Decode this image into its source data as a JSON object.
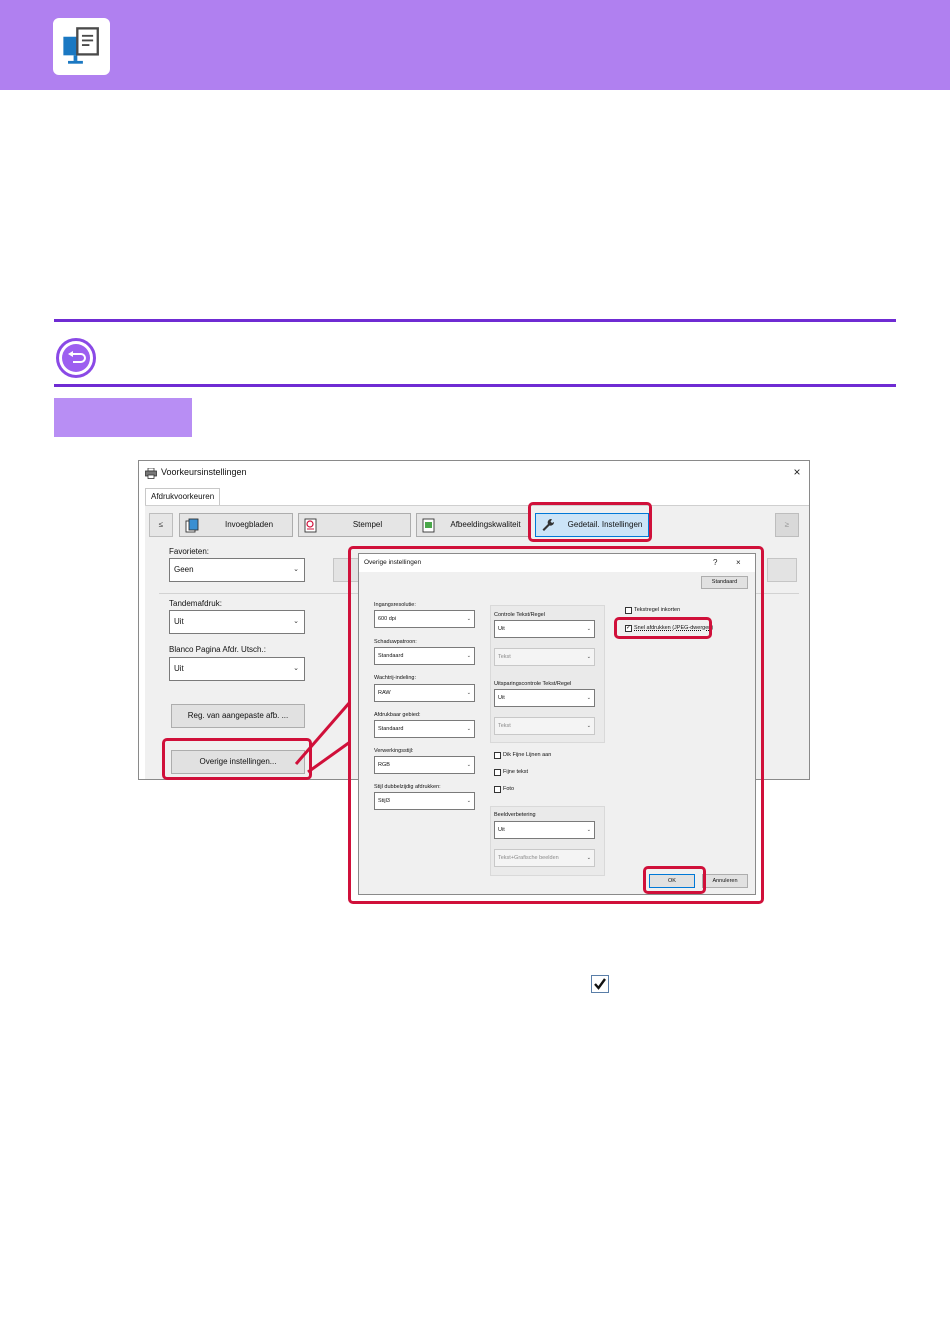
{
  "main_dialog": {
    "title": "Voorkeursinstellingen",
    "close_glyph": "×",
    "tab": "Afdrukvoorkeuren",
    "nav_prev": "≤",
    "nav_next": "≥",
    "tabs": [
      {
        "label": "Invoegbladen",
        "icon": "inserts-icon"
      },
      {
        "label": "Stempel",
        "icon": "stamp-icon"
      },
      {
        "label": "Afbeeldingskwaliteit",
        "icon": "image-quality-icon"
      },
      {
        "label": "Gedetail. Instellingen",
        "icon": "wrench-icon"
      }
    ],
    "favorieten": {
      "label": "Favorieten:",
      "value": "Geen"
    },
    "tandemafdruk": {
      "label": "Tandemafdruk:",
      "value": "Uit"
    },
    "blanco_pagina": {
      "label": "Blanco Pagina Afdr. Utsch.:",
      "value": "Uit"
    },
    "reg_button": "Reg. van aangepaste afb. ...",
    "overige_button": "Overige instellingen..."
  },
  "sub_dialog": {
    "title": "Overige instellingen",
    "help_glyph": "?",
    "close_glyph": "×",
    "standaard_button": "Standaard",
    "ingangsresolutie": {
      "label": "Ingangsresolutie:",
      "value": "600 dpi"
    },
    "schaduwpatroon": {
      "label": "Schaduwpatroon:",
      "value": "Standaard"
    },
    "wachtrij": {
      "label": "Wachtrij-indeling:",
      "value": "RAW"
    },
    "afdrukbaar": {
      "label": "Afdrukbaar gebied:",
      "value": "Standaard"
    },
    "verwerkingsstijl": {
      "label": "Verwerkingsstijl:",
      "value": "RGB"
    },
    "stijl_dubbel": {
      "label": "Stijl dubbelzijdig afdrukken:",
      "value": "Stijl3"
    },
    "controle": {
      "label": "Controle Tekst/Regel",
      "value": "Uit",
      "sub_value": "Tekst"
    },
    "uitsparing": {
      "label": "Uitsparingscontrole Tekst/Regel",
      "value": "Uit",
      "sub_value": "Tekst"
    },
    "check_dik": "Dik Fijne Lijnen aan",
    "check_fijne": "Fijne tekst",
    "check_foto": "Foto",
    "beeldverbetering": {
      "label": "Beeldverbetering",
      "value": "Uit",
      "sub_value": "Tekst+Grafische beelden"
    },
    "check_tekst_inkorten": "Tekstregel inkorten",
    "check_snel": "Snel afdrukken (JPEG-dwergen)",
    "check_snel_mark": "✓",
    "ok_button": "OK",
    "annuleren_button": "Annuleren",
    "chevron_glyph": "⌄"
  },
  "colors": {
    "header_bg": "#b080f0",
    "rule": "#6f2bd3",
    "highlight_red": "#d0103a",
    "step_box": "#b88ef4"
  }
}
